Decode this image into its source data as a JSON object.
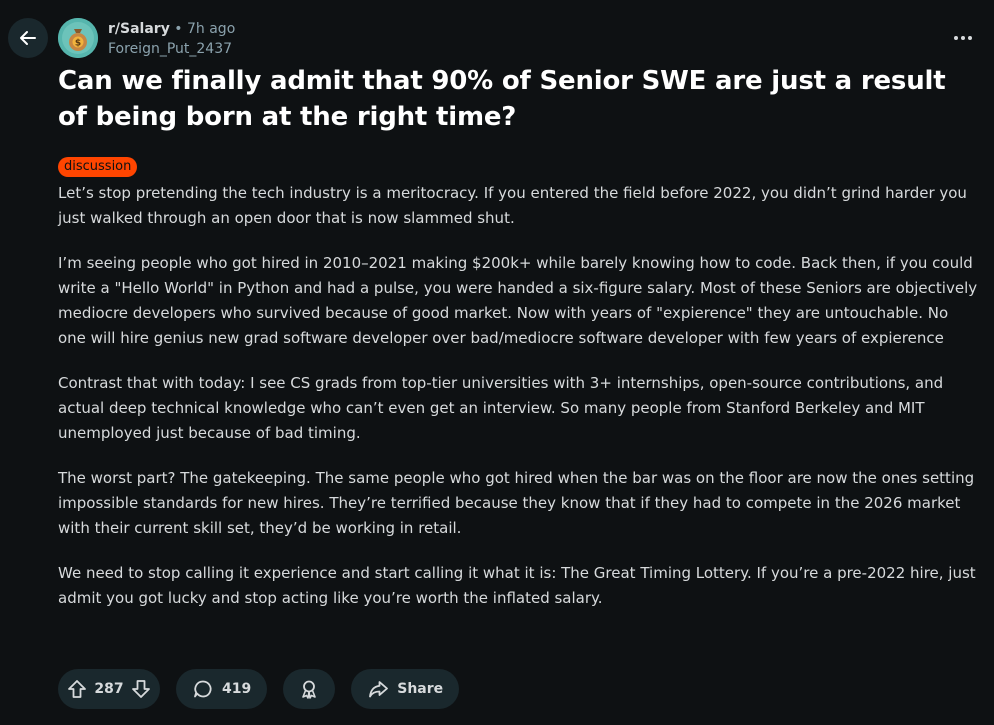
{
  "header": {
    "subreddit": "r/Salary",
    "dot": "•",
    "time_ago": "7h ago",
    "author": "Foreign_Put_2437"
  },
  "post": {
    "title": "Can we finally admit that 90% of Senior SWE are just a result of being born at the right time?",
    "flair": "discussion",
    "paragraphs": [
      "Let’s stop pretending the tech industry is a meritocracy. If you entered the field before 2022, you didn’t grind harder you just walked through an open door that is now slammed shut.",
      "I’m seeing people who got hired in 2010–2021 making $200k+ while barely knowing how to code. Back then, if you could write a \"Hello World\" in Python and had a pulse, you were handed a six-figure salary. Most of these Seniors are objectively mediocre developers who survived because of good market. Now with years of \"expierence\" they are untouchable. No one will hire genius new grad software developer over bad/mediocre software developer with few years of expierence",
      "Contrast that with today: I see CS grads from top-tier universities with 3+ internships, open-source contributions, and actual deep technical knowledge who can’t even get an interview. So many people from Stanford Berkeley and MIT unemployed just because of bad timing.",
      "The worst part? The gatekeeping. The same people who got hired when the bar was on the floor are now the ones setting impossible standards for new hires. They’re terrified because they know that if they had to compete in the 2026 market with their current skill set, they’d be working in retail.",
      "We need to stop calling it experience and start calling it what it is: The Great Timing Lottery. If you’re a pre-2022 hire, just admit you got lucky and stop acting like you’re worth the inflated salary."
    ]
  },
  "actions": {
    "votes": "287",
    "comments": "419",
    "share_label": "Share"
  },
  "icons": {
    "back": "arrow-left-icon",
    "avatar": "money-bag-icon",
    "more": "ellipsis-icon",
    "upvote": "upvote-arrow-icon",
    "downvote": "downvote-arrow-icon",
    "comment": "speech-bubble-icon",
    "award": "award-ribbon-icon",
    "share": "share-arrow-icon"
  },
  "colors": {
    "background": "#0e1113",
    "flair": "#ff4500",
    "pill": "#1a282d",
    "muted_text": "#8ba2ad"
  }
}
